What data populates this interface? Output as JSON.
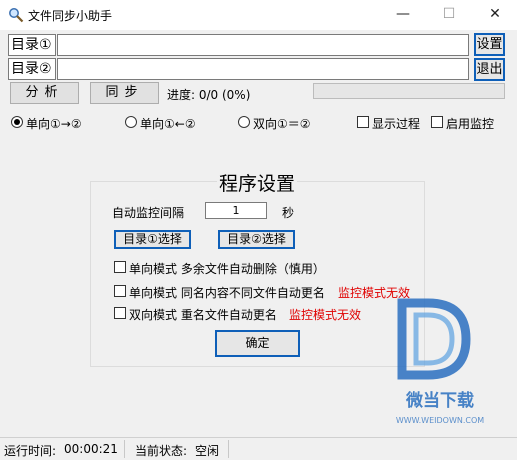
{
  "window": {
    "title": "文件同步小助手",
    "icon": "magnifier-icon",
    "controls": [
      "minimize-icon",
      "maximize-icon",
      "close-icon"
    ]
  },
  "dirs": [
    {
      "label": "目录①",
      "value": ""
    },
    {
      "label": "目录②",
      "value": ""
    }
  ],
  "side_buttons": {
    "settings": "设置",
    "exit": "退出"
  },
  "actions": {
    "analyze": "分析",
    "sync": "同步",
    "progress_label": "进度: 0/0 (0%)",
    "progress_fraction": 0
  },
  "modes": [
    {
      "label": "单向①→②",
      "selected": true
    },
    {
      "label": "单向①←②",
      "selected": false
    },
    {
      "label": "双向①＝②",
      "selected": false
    }
  ],
  "toggles": {
    "show_process": {
      "label": "显示过程",
      "checked": false
    },
    "enable_monitor": {
      "label": "启用监控",
      "checked": false
    }
  },
  "settings": {
    "title": "程序设置",
    "interval_label": "自动监控间隔",
    "interval_value": "1",
    "interval_unit": "秒",
    "dir1_select": "目录①选择",
    "dir2_select": "目录②选择",
    "options": [
      {
        "label": "单向模式 多余文件自动删除（慎用）",
        "checked": false,
        "warning": ""
      },
      {
        "label": "单向模式 同名内容不同文件自动更名",
        "checked": false,
        "warning": "监控模式无效"
      },
      {
        "label": "双向模式 重名文件自动更名",
        "checked": false,
        "warning": "监控模式无效"
      }
    ],
    "ok": "确定"
  },
  "status": {
    "run_time_label": "运行时间:",
    "run_time": "00:00:21",
    "state_label": "当前状态:",
    "state": "空闲"
  },
  "watermark": {
    "name": "微当下载",
    "url": "WWW.WEIDOWN.COM"
  },
  "colors": {
    "focus_border": "#0e5fb8",
    "warning": "#e00000",
    "watermark": "#2a6fbf"
  }
}
